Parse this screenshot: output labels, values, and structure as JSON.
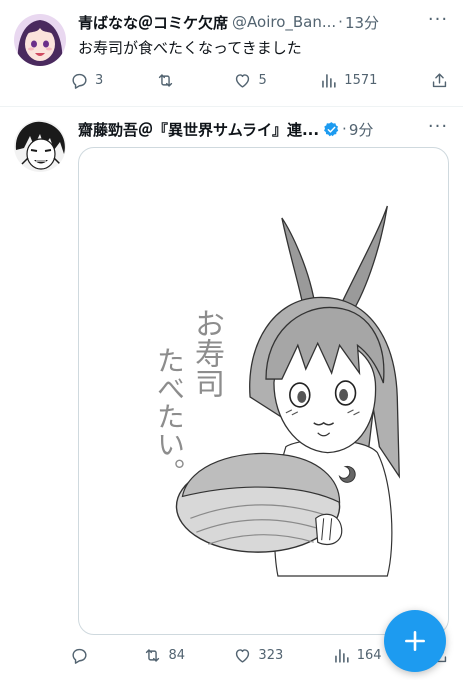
{
  "timeline": {
    "tweets": [
      {
        "display_name": "青ばなな＠コミケ欠席",
        "handle": "@Aoiro_Ban...",
        "dot": "·",
        "time": "13分",
        "text": "お寿司が食べたくなってきました",
        "more_icon": "···",
        "stats": {
          "replies": "3",
          "retweets": "",
          "likes": "5",
          "views": "1571"
        },
        "avatar_icon": "anime-avatar-purple-hair"
      },
      {
        "display_name": "齋藤勁吾＠『異世界サムライ』連...",
        "verified": true,
        "dot": "·",
        "time": "9分",
        "more_icon": "···",
        "image_alt": "sketch-girl-holding-sushi",
        "image_text_line1": "お寿司",
        "image_text_line2": "たべたい。",
        "stats": {
          "replies": "",
          "retweets": "84",
          "likes": "323",
          "views": "164"
        },
        "avatar_icon": "manga-avatar-bw"
      }
    ]
  },
  "fab": {
    "icon": "plus-compose-icon",
    "color": "#1d9bf0"
  },
  "colors": {
    "accent": "#1d9bf0",
    "muted": "#536471",
    "text": "#0f1419",
    "border": "#cfd9de"
  }
}
